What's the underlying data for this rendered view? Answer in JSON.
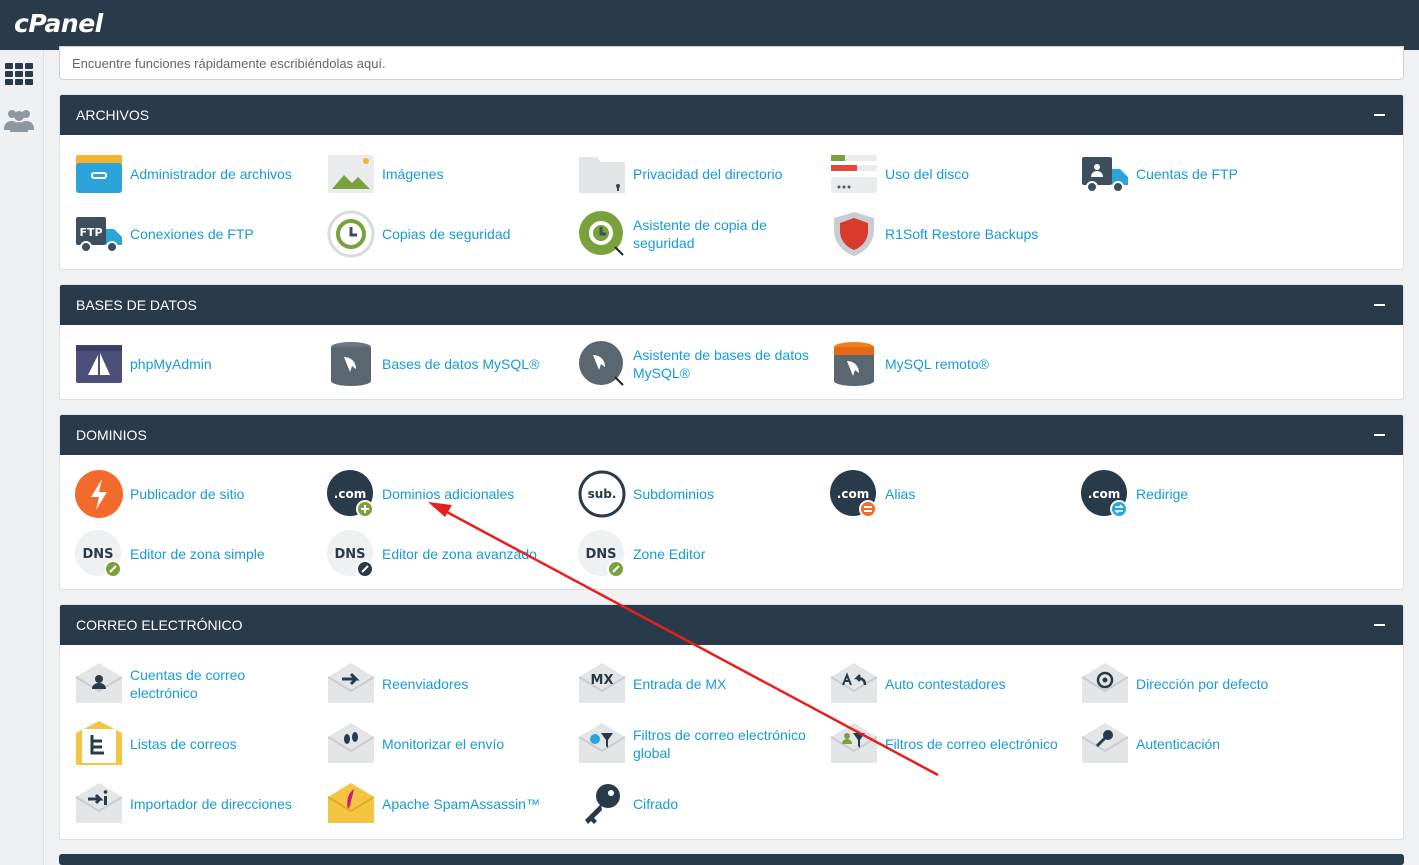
{
  "app": {
    "logo": "cPanel"
  },
  "search": {
    "placeholder": "Encuentre funciones rápidamente escribiéndolas aquí."
  },
  "sections": {
    "archivos": {
      "title": "ARCHIVOS",
      "items": [
        "Administrador de archivos",
        "Imágenes",
        "Privacidad del directorio",
        "Uso del disco",
        "Cuentas de FTP",
        "Conexiones de FTP",
        "Copias de seguridad",
        "Asistente de copia de seguridad",
        "R1Soft Restore Backups"
      ]
    },
    "bases": {
      "title": "BASES DE DATOS",
      "items": [
        "phpMyAdmin",
        "Bases de datos MySQL®",
        "Asistente de bases de datos MySQL®",
        "MySQL remoto®"
      ]
    },
    "dominios": {
      "title": "DOMINIOS",
      "items": [
        "Publicador de sitio",
        "Dominios adicionales",
        "Subdominios",
        "Alias",
        "Redirige",
        "Editor de zona simple",
        "Editor de zona avanzado",
        "Zone Editor"
      ]
    },
    "correo": {
      "title": "CORREO ELECTRÓNICO",
      "items": [
        "Cuentas de correo electrónico",
        "Reenviadores",
        "Entrada de MX",
        "Auto contestadores",
        "Dirección por defecto",
        "Listas de correos",
        "Monitorizar el envío",
        "Filtros de correo electrónico global",
        "Filtros de correo electrónico",
        "Autenticación",
        "Importador de direcciones",
        "Apache SpamAssassin™",
        "Cifrado"
      ]
    }
  },
  "icon_text": {
    "ftp": "FTP",
    "com": ".com",
    "sub": "sub.",
    "dns": "DNS",
    "mx": "MX"
  },
  "colors": {
    "header": "#293a4a",
    "link": "#179bd7",
    "arrow": "#e8201d"
  }
}
